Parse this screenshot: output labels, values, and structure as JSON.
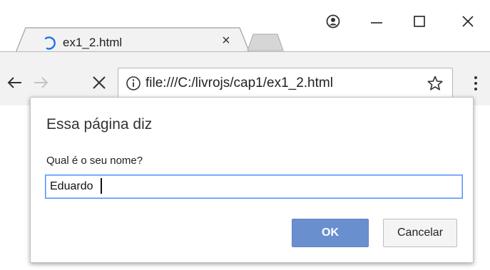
{
  "tab": {
    "title": "ex1_2.html",
    "close_glyph": "×",
    "favicon": "loading-spinner-icon"
  },
  "window_controls": {
    "profile_icon": "profile-icon",
    "minimize_icon": "minimize-icon",
    "maximize_icon": "maximize-icon",
    "close_icon": "close-icon"
  },
  "toolbar": {
    "back_icon": "back-arrow-icon",
    "forward_icon": "forward-arrow-icon",
    "stop_icon": "stop-icon",
    "url": "file:///C:/livrojs/cap1/ex1_2.html",
    "info_icon": "info-icon",
    "bookmark_icon": "star-icon",
    "menu_icon": "kebab-menu-icon"
  },
  "dialog": {
    "title": "Essa página diz",
    "message": "Qual é o seu nome?",
    "input_value": "Eduardo",
    "ok_label": "OK",
    "cancel_label": "Cancelar"
  },
  "colors": {
    "ok_button": "#6a8fcf",
    "input_focus_border": "#4d90fe",
    "toolbar_bg": "#f2f2f2"
  }
}
